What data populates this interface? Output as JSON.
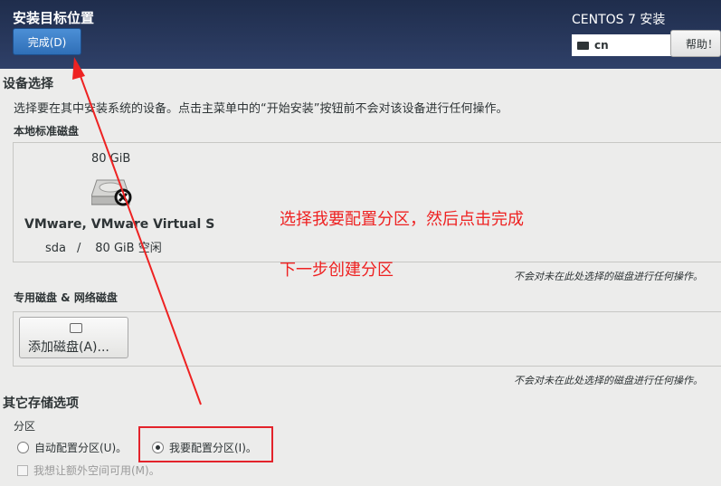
{
  "header": {
    "title": "安装目标位置",
    "done_button": "完成(D)",
    "product": "CENTOS 7 安装",
    "keyboard_layout": "cn",
    "help_button": "帮助！"
  },
  "device_selection": {
    "heading": "设备选择",
    "description": "选择要在其中安装系统的设备。点击主菜单中的“开始安装”按钮前不会对该设备进行任何操作。",
    "local_disks_label": "本地标准磁盘",
    "disk": {
      "size": "80 GiB",
      "name": "VMware, VMware Virtual S",
      "device": "sda",
      "separator": "/",
      "free": "80 GiB 空闲",
      "selected": true
    },
    "local_note": "不会对未在此处选择的磁盘进行任何操作。",
    "special_disks_label": "专用磁盘 & 网络磁盘",
    "add_disk_button": "添加磁盘(A)...",
    "special_note": "不会对未在此处选择的磁盘进行任何操作。"
  },
  "other_storage": {
    "heading": "其它存储选项",
    "partition_label": "分区",
    "auto_option": "自动配置分区(U)。",
    "manual_option": "我要配置分区(I)。",
    "selected_option": "manual",
    "extra_space_option": "我想让额外空间可用(M)。"
  },
  "annotation": {
    "line1": "选择我要配置分区，然后点击完成",
    "line2": "下一步创建分区",
    "color": "#ee2222"
  },
  "colors": {
    "header_bg": "#1f2d4c",
    "done_button": "#3a7cc4",
    "highlight": "#e3232b"
  }
}
